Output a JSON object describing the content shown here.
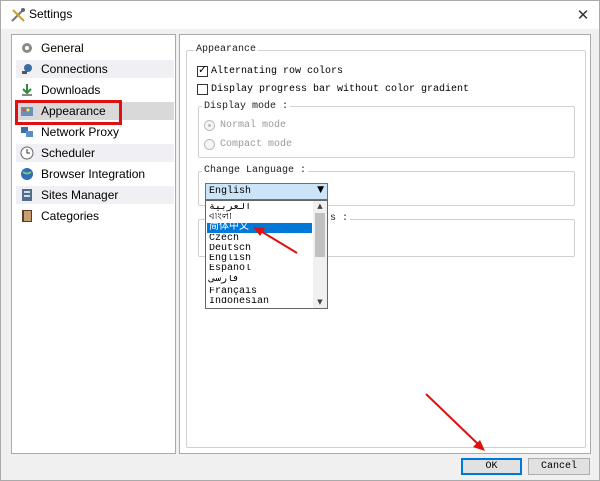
{
  "window": {
    "title": "Settings",
    "close_glyph": "✕"
  },
  "sidebar": {
    "items": [
      {
        "label": "General",
        "icon": "gear-icon"
      },
      {
        "label": "Connections",
        "icon": "plug-icon"
      },
      {
        "label": "Downloads",
        "icon": "download-arrow-icon"
      },
      {
        "label": "Appearance",
        "icon": "palette-icon",
        "selected": true
      },
      {
        "label": "Network Proxy",
        "icon": "network-icon"
      },
      {
        "label": "Scheduler",
        "icon": "clock-icon"
      },
      {
        "label": "Browser Integration",
        "icon": "globe-icon"
      },
      {
        "label": "Sites Manager",
        "icon": "server-icon"
      },
      {
        "label": "Categories",
        "icon": "book-icon"
      }
    ]
  },
  "appearance": {
    "group_title": "Appearance",
    "alternating_rows": {
      "label": "Alternating row colors",
      "checked": true
    },
    "progress_no_gradient": {
      "label": "Display progress bar without color gradient",
      "checked": false
    },
    "display_mode": {
      "title": "Display mode :",
      "normal": "Normal mode",
      "compact": "Compact mode"
    },
    "change_language": {
      "title": "Change Language :",
      "selected_value": "English",
      "options": [
        "العربية",
        "বাংলা",
        "简体中文",
        "Czech",
        "Deutsch",
        "English",
        "Español",
        "فارسی",
        "Français",
        "Indonesian"
      ],
      "highlighted_option": "简体中文"
    },
    "hidden_group_title_tail": "s :"
  },
  "buttons": {
    "ok": "OK",
    "cancel": "Cancel"
  },
  "colors": {
    "annotation_red": "#e01010",
    "selection_blue": "#0078d7"
  }
}
